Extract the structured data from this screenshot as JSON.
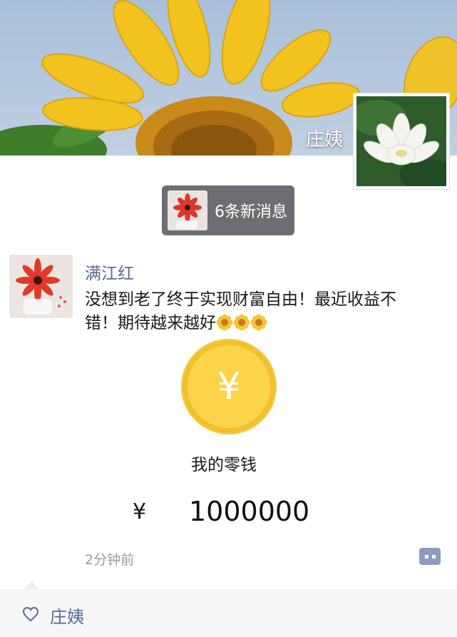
{
  "cover": {
    "name": "庄姨"
  },
  "notification": {
    "text": "6条新消息"
  },
  "post": {
    "author": "满江红",
    "text": "没想到老了终于实现财富自由！最近收益不错！期待越来越好",
    "emojis": [
      "flower-icon",
      "flower-icon",
      "flower-icon"
    ],
    "coin_symbol": "¥",
    "wallet_label": "我的零钱",
    "currency_symbol": "¥",
    "amount": "1000000",
    "time": "2分钟前"
  },
  "likes": {
    "names": "庄姨"
  },
  "colors": {
    "link": "#576b95",
    "coin": "#fbd44a",
    "more_button": "#8d9bc2"
  }
}
